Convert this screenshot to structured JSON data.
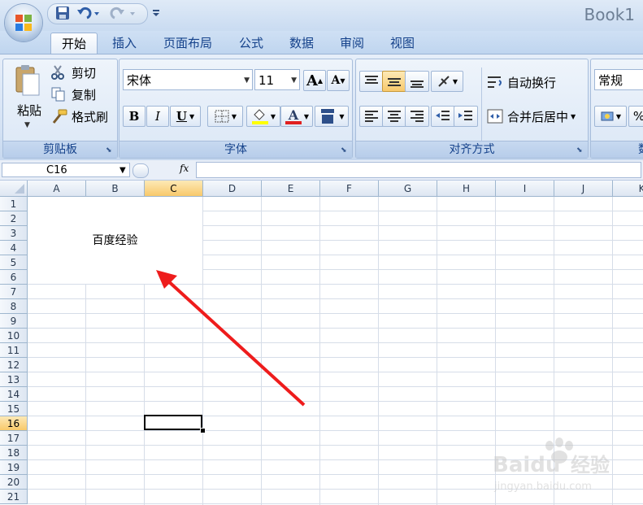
{
  "window": {
    "title": "Book1"
  },
  "tabs": [
    {
      "label": "开始",
      "active": true
    },
    {
      "label": "插入"
    },
    {
      "label": "页面布局"
    },
    {
      "label": "公式"
    },
    {
      "label": "数据"
    },
    {
      "label": "审阅"
    },
    {
      "label": "视图"
    }
  ],
  "clipboard": {
    "group_label": "剪贴板",
    "paste_label": "粘贴",
    "cut_label": "剪切",
    "copy_label": "复制",
    "format_painter_label": "格式刷"
  },
  "font": {
    "group_label": "字体",
    "font_name": "宋体",
    "font_size": "11",
    "bold": "B",
    "italic": "I",
    "underline": "U",
    "grow": "A",
    "shrink": "A"
  },
  "alignment": {
    "group_label": "对齐方式",
    "wrap_text_label": "自动换行",
    "merge_center_label": "合并后居中"
  },
  "number": {
    "format": "常规",
    "percent": "%",
    "group_label_partial": "数"
  },
  "formula_bar": {
    "name_box": "C16",
    "fx": "fx",
    "formula": ""
  },
  "grid": {
    "columns": [
      "A",
      "B",
      "C",
      "D",
      "E",
      "F",
      "G",
      "H",
      "I",
      "J",
      "K"
    ],
    "rows": [
      "1",
      "2",
      "3",
      "4",
      "5",
      "6",
      "7",
      "8",
      "9",
      "10",
      "11",
      "12",
      "13",
      "14",
      "15",
      "16",
      "17",
      "18",
      "19",
      "20",
      "21"
    ],
    "selected_column": "C",
    "selected_row": "16",
    "merged_cell_text": "百度经验"
  },
  "colors": {
    "accent": "#15428b",
    "highlight": "#f8c96b",
    "arrow": "#ee1c1c",
    "font_color_bar": "#e02020",
    "fill_color_bar": "#ffff00"
  },
  "watermark": {
    "brand": "Baidu",
    "brand_cn": "经验",
    "url": "jingyan.baidu.com"
  }
}
